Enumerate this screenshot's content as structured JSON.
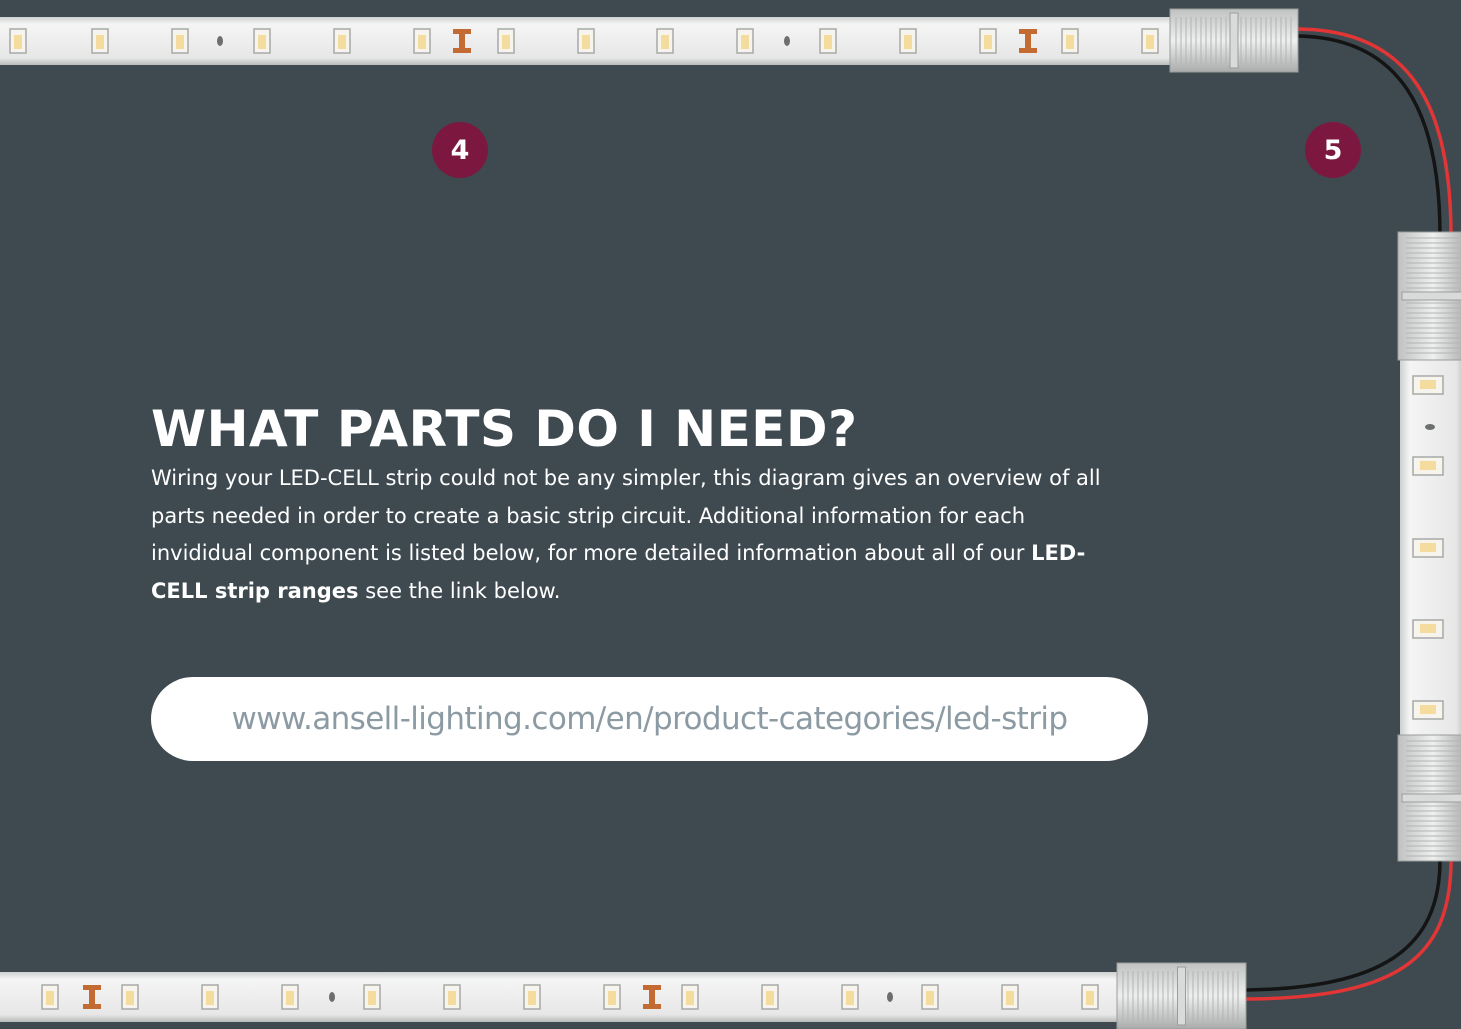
{
  "markers": {
    "step_4": "4",
    "step_5": "5"
  },
  "heading": "WHAT PARTS DO I NEED?",
  "intro": {
    "text_lead": "Wiring your LED-CELL strip could not be any simpler, this diagram gives an overview of all parts needed in order to create a basic strip circuit. Additional information for each invididual component is listed below, for more detailed information about all of our",
    "bold_link_text": "LED-CELL strip ranges",
    "text_tail": "see the link below."
  },
  "link": {
    "url_text": "www.ansell-lighting.com/en/product-categories/led-strip"
  },
  "colors": {
    "background": "#3e4a50",
    "marker": "#7c1840",
    "strip": "#e5e6e5",
    "led_chip": "#f3dc9e",
    "resistor": "#c46a33",
    "wire_red": "#e33535",
    "wire_black": "#141414",
    "url_text": "#8c9ba3"
  }
}
